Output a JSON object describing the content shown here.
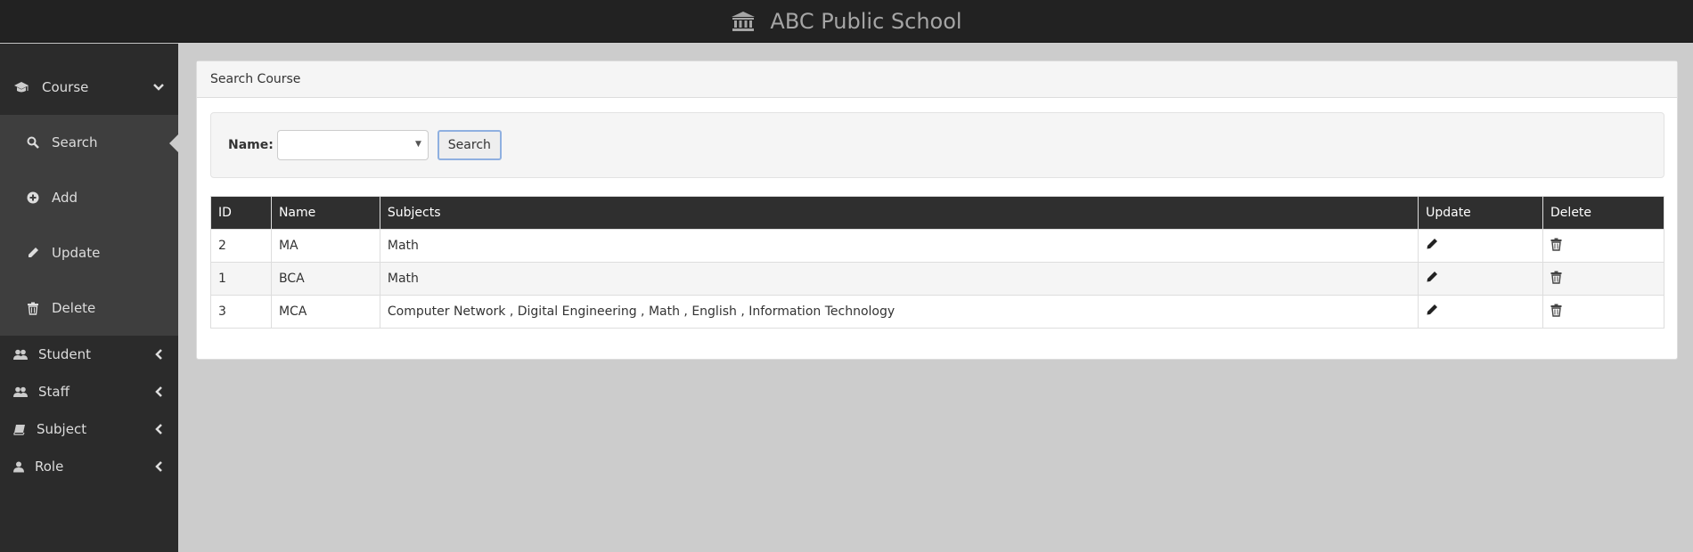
{
  "header": {
    "title": "ABC Public School",
    "icon": "bank-icon"
  },
  "sidebar": {
    "course": {
      "label": "Course",
      "icon": "graduation-cap-icon",
      "items": [
        {
          "label": "Search",
          "icon": "search-icon",
          "active": true
        },
        {
          "label": "Add",
          "icon": "plus-circle-icon"
        },
        {
          "label": "Update",
          "icon": "pencil-icon"
        },
        {
          "label": "Delete",
          "icon": "trash-icon"
        }
      ]
    },
    "items": [
      {
        "label": "Student",
        "icon": "users-icon"
      },
      {
        "label": "Staff",
        "icon": "users-icon"
      },
      {
        "label": "Subject",
        "icon": "book-icon"
      },
      {
        "label": "Role",
        "icon": "user-icon"
      }
    ]
  },
  "panel": {
    "title": "Search Course",
    "search": {
      "name_label": "Name:",
      "selected_value": "",
      "button_label": "Search"
    },
    "table": {
      "columns": [
        "ID",
        "Name",
        "Subjects",
        "Update",
        "Delete"
      ],
      "rows": [
        {
          "id": "2",
          "name": "MA",
          "subjects": "Math"
        },
        {
          "id": "1",
          "name": "BCA",
          "subjects": "Math"
        },
        {
          "id": "3",
          "name": "MCA",
          "subjects": "Computer Network , Digital Engineering , Math , English , Information Technology"
        }
      ]
    }
  },
  "colors": {
    "topbar": "#222222",
    "sidebar": "#2b2b2b",
    "submenu": "#3e3e3e",
    "table_header": "#2f2f2f",
    "background": "#cccccc"
  }
}
